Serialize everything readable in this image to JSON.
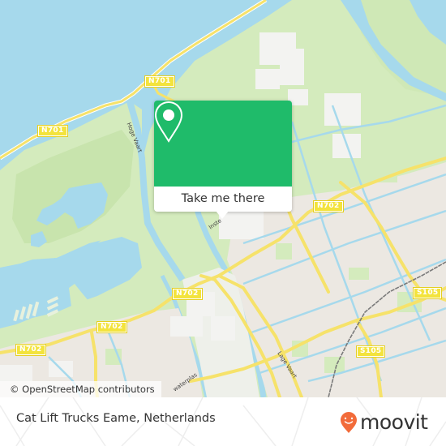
{
  "map": {
    "colors": {
      "water": "#a6d9ec",
      "land_green": "#d4ebbd",
      "land_light_green": "#e4f1d5",
      "urban": "#ece8e2",
      "road": "#f6e26a",
      "canal": "#a6d9ec",
      "rail": "#777777"
    },
    "road_labels": [
      {
        "text": "N701",
        "id": "n701-north"
      },
      {
        "text": "N701",
        "id": "n701-west"
      },
      {
        "text": "N702",
        "id": "n702-east"
      },
      {
        "text": "N702",
        "id": "n702-center"
      },
      {
        "text": "N702",
        "id": "n702-west"
      },
      {
        "text": "N702",
        "id": "n702-southwest"
      },
      {
        "text": "S105",
        "id": "s105-east"
      },
      {
        "text": "S105",
        "id": "s105-south"
      }
    ],
    "street_labels": [
      {
        "text": "Hoge Vaart"
      },
      {
        "text": "Lage Vaart"
      },
      {
        "text": "Inste"
      },
      {
        "text": "waterplas"
      }
    ],
    "attribution": "© OpenStreetMap contributors"
  },
  "popup": {
    "icon": "map-pin-icon",
    "button_label": "Take me there",
    "accent_color": "#1fbb6a"
  },
  "footer": {
    "place_name": "Cat Lift Trucks Eame, Netherlands",
    "brand": "moovit",
    "brand_color": "#f26b3a"
  }
}
